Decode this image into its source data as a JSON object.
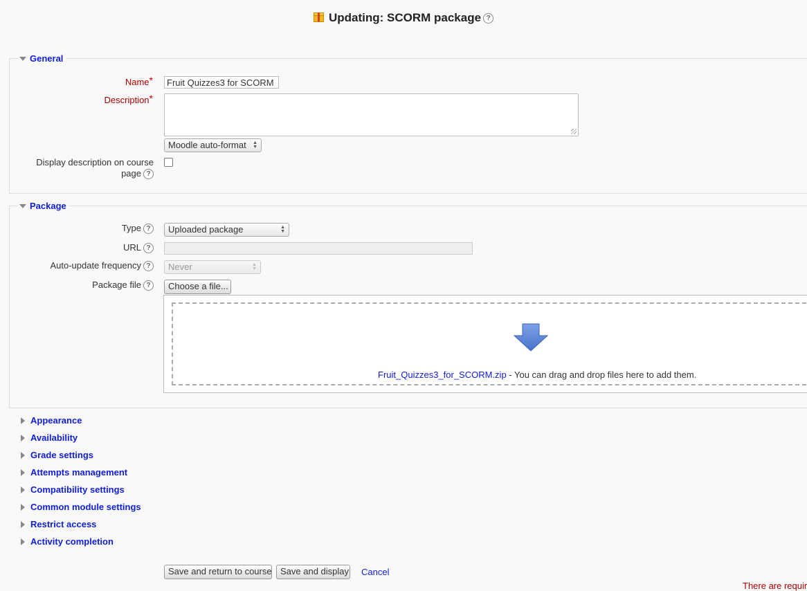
{
  "page": {
    "title": "Updating: SCORM package",
    "help_glyph": "?",
    "title_icon": "scorm-package-icon"
  },
  "general": {
    "legend": "General",
    "name_label": "Name",
    "name_value": "Fruit Quizzes3 for SCORM",
    "description_label": "Description",
    "description_value": "",
    "format_select": "Moodle auto-format",
    "display_desc_label_1": "Display description on course",
    "display_desc_label_2": "page",
    "display_desc_checked": false,
    "required_star": "*"
  },
  "package": {
    "legend": "Package",
    "type_label": "Type",
    "type_value": "Uploaded package",
    "url_label": "URL",
    "url_value": "",
    "autoupdate_label": "Auto-update frequency",
    "autoupdate_value": "Never",
    "file_label": "Package file",
    "choose_file_button": "Choose a file...",
    "file_name": "Fruit_Quizzes3_for_SCORM.zip",
    "drop_hint": " - You can drag and drop files here to add them."
  },
  "collapsed_sections": [
    "Appearance",
    "Availability",
    "Grade settings",
    "Attempts management",
    "Compatibility settings",
    "Common module settings",
    "Restrict access",
    "Activity completion"
  ],
  "actions": {
    "save_return": "Save and return to course",
    "save_display": "Save and display",
    "cancel": "Cancel"
  },
  "footer": {
    "required_note": "There are requir"
  },
  "colors": {
    "link": "#0f1ddb",
    "required": "#aa0000",
    "background": "#f9f9f9",
    "arrow_blue": "#5b86d6"
  }
}
